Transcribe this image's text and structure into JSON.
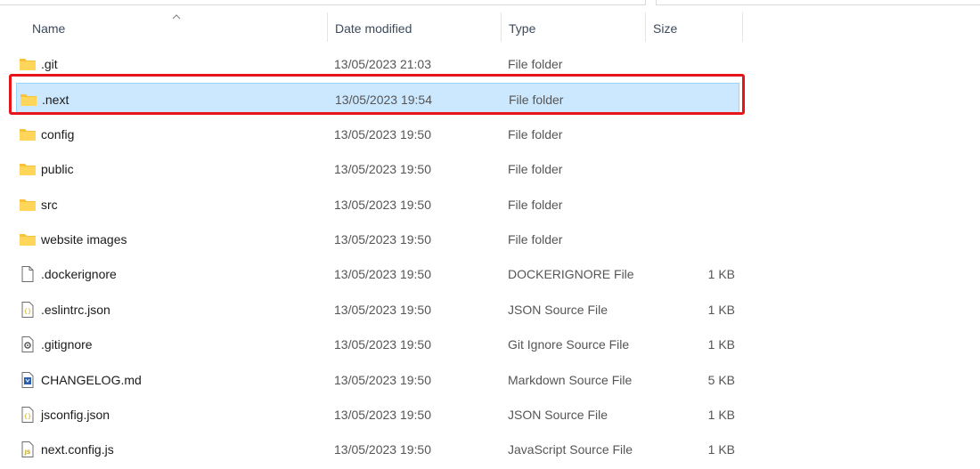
{
  "columns": {
    "name": "Name",
    "date": "Date modified",
    "type": "Type",
    "size": "Size"
  },
  "sort": {
    "column": "name",
    "direction": "ascending"
  },
  "selected_item": ".next",
  "files": [
    {
      "name": ".git",
      "date": "13/05/2023 21:03",
      "type": "File folder",
      "size": "",
      "icon": "folder-icon"
    },
    {
      "name": ".next",
      "date": "13/05/2023 19:54",
      "type": "File folder",
      "size": "",
      "icon": "folder-icon"
    },
    {
      "name": "config",
      "date": "13/05/2023 19:50",
      "type": "File folder",
      "size": "",
      "icon": "folder-icon"
    },
    {
      "name": "public",
      "date": "13/05/2023 19:50",
      "type": "File folder",
      "size": "",
      "icon": "folder-icon"
    },
    {
      "name": "src",
      "date": "13/05/2023 19:50",
      "type": "File folder",
      "size": "",
      "icon": "folder-icon"
    },
    {
      "name": "website images",
      "date": "13/05/2023 19:50",
      "type": "File folder",
      "size": "",
      "icon": "folder-icon"
    },
    {
      "name": ".dockerignore",
      "date": "13/05/2023 19:50",
      "type": "DOCKERIGNORE File",
      "size": "1 KB",
      "icon": "blank-file-icon"
    },
    {
      "name": ".eslintrc.json",
      "date": "13/05/2023 19:50",
      "type": "JSON Source File",
      "size": "1 KB",
      "icon": "json-file-icon"
    },
    {
      "name": ".gitignore",
      "date": "13/05/2023 19:50",
      "type": "Git Ignore Source File",
      "size": "1 KB",
      "icon": "gear-file-icon"
    },
    {
      "name": "CHANGELOG.md",
      "date": "13/05/2023 19:50",
      "type": "Markdown Source File",
      "size": "5 KB",
      "icon": "markdown-file-icon"
    },
    {
      "name": "jsconfig.json",
      "date": "13/05/2023 19:50",
      "type": "JSON Source File",
      "size": "1 KB",
      "icon": "json-file-icon"
    },
    {
      "name": "next.config.js",
      "date": "13/05/2023 19:50",
      "type": "JavaScript Source File",
      "size": "1 KB",
      "icon": "js-file-icon"
    }
  ],
  "colors": {
    "selection_bg": "#cce8ff",
    "selection_border": "#99d1ff",
    "highlight_box": "#e8141c",
    "folder": "#f8c33c"
  }
}
